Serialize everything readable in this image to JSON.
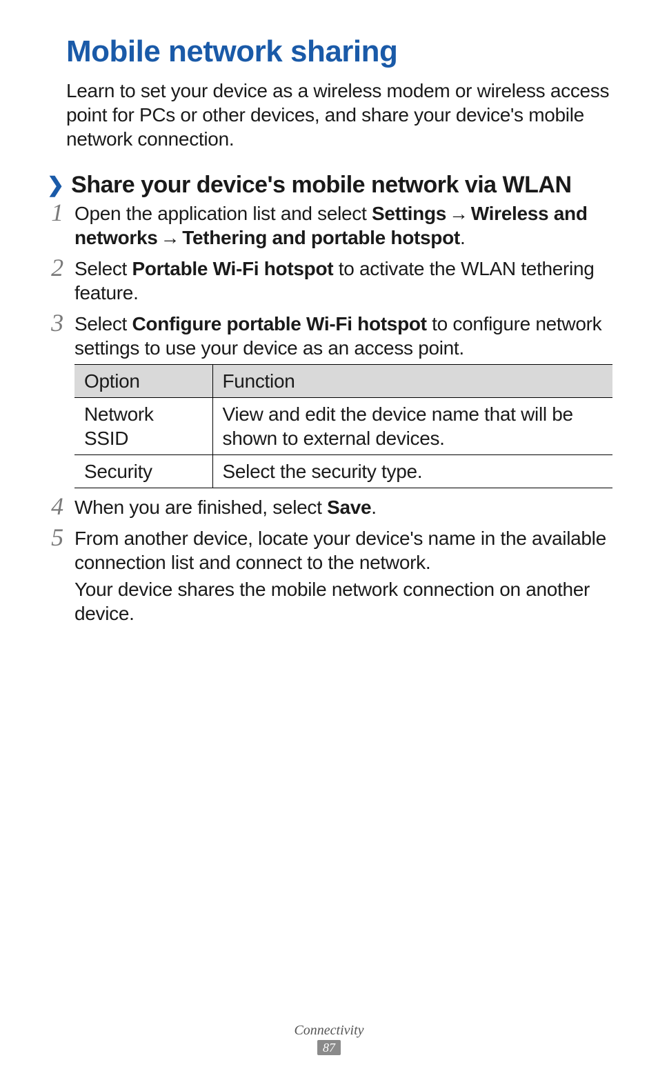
{
  "title": "Mobile network sharing",
  "intro": "Learn to set your device as a wireless modem or wireless access point for PCs or other devices, and share your device's mobile network connection.",
  "chevron": "❯",
  "subhead": "Share your device's mobile network via WLAN",
  "arrow": "→",
  "steps": {
    "s1": {
      "t1": "Open the application list and select ",
      "b1": "Settings",
      "b2": "Wireless and networks",
      "b3": "Tethering and portable hotspot",
      "end": "."
    },
    "s2": {
      "t1": "Select ",
      "b1": "Portable Wi-Fi hotspot",
      "t2": " to activate the WLAN tethering feature."
    },
    "s3": {
      "t1": "Select ",
      "b1": "Configure portable Wi-Fi hotspot",
      "t2": " to configure network settings to use your device as an access point."
    },
    "s4": {
      "t1": "When you are finished, select ",
      "b1": "Save",
      "end": "."
    },
    "s5": {
      "t1": "From another device, locate your device's name in the available connection list and connect to the network.",
      "t2": "Your device shares the mobile network connection on another device."
    }
  },
  "table": {
    "head": {
      "c1": "Option",
      "c2": "Function"
    },
    "rows": [
      {
        "c1": "Network SSID",
        "c2": "View and edit the device name that will be shown to external devices."
      },
      {
        "c1": "Security",
        "c2": "Select the security type."
      }
    ]
  },
  "footer": {
    "section": "Connectivity",
    "page": "87"
  }
}
